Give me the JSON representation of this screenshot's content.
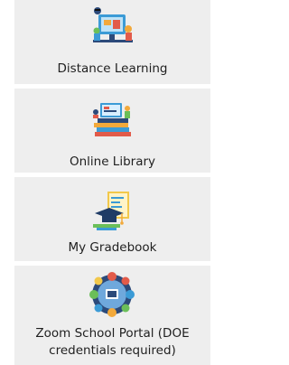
{
  "tiles": [
    {
      "label": "Distance Learning",
      "icon": "distance-learning-illustration"
    },
    {
      "label": "Online Library",
      "icon": "online-library-illustration"
    },
    {
      "label": "My Gradebook",
      "icon": "gradebook-illustration"
    },
    {
      "label": "Zoom School Portal (DOE credentials required)",
      "icon": "zoom-portal-illustration"
    }
  ],
  "colors": {
    "tile_bg": "#eeeeee",
    "text": "#1f1f1f"
  }
}
